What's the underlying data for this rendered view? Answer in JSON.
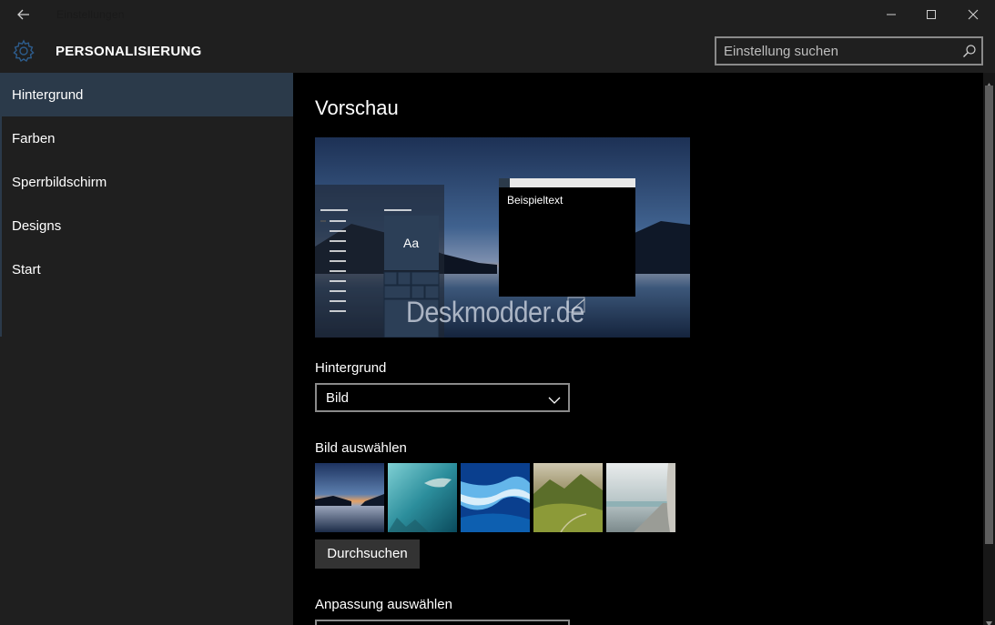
{
  "window": {
    "title": "Einstellungen"
  },
  "header": {
    "title": "PERSONALISIERUNG",
    "search_placeholder": "Einstellung suchen"
  },
  "sidebar": {
    "items": [
      {
        "label": "Hintergrund",
        "active": true
      },
      {
        "label": "Farben",
        "active": false
      },
      {
        "label": "Sperrbildschirm",
        "active": false
      },
      {
        "label": "Designs",
        "active": false
      },
      {
        "label": "Start",
        "active": false
      }
    ]
  },
  "main": {
    "preview_heading": "Vorschau",
    "preview": {
      "tile_text": "Aa",
      "window_text": "Beispieltext",
      "watermark": "Deskmodder.de"
    },
    "background_label": "Hintergrund",
    "background_value": "Bild",
    "choose_image_label": "Bild auswählen",
    "thumbnails": [
      "lake-sunset",
      "underwater",
      "blue-wave",
      "green-hills",
      "coast-road"
    ],
    "browse_label": "Durchsuchen",
    "fit_label": "Anpassung auswählen"
  },
  "colors": {
    "chrome": "#1f1f1f",
    "accent_selected": "#2b3a4a",
    "content_bg": "#000000"
  }
}
